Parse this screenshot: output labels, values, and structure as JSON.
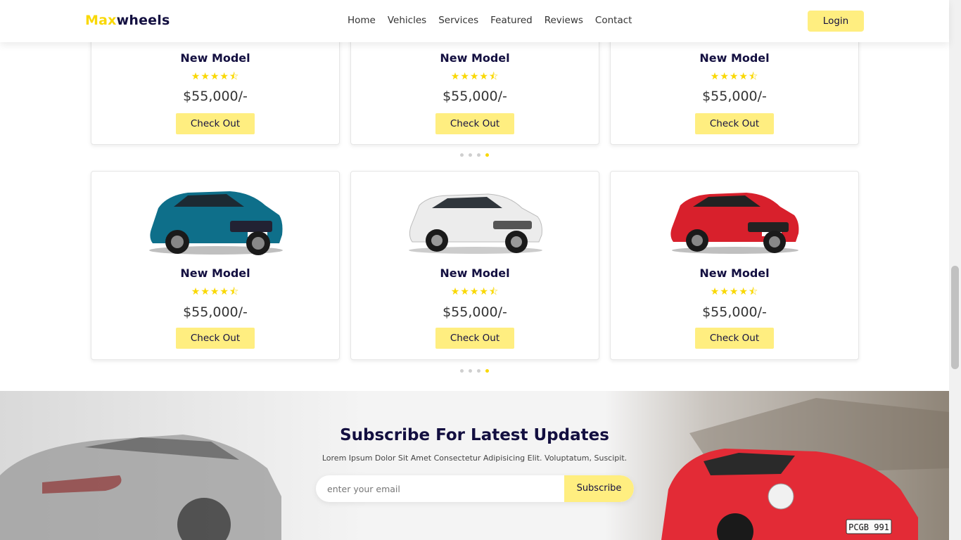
{
  "header": {
    "logo_accent": "Max",
    "logo_rest": "wheels",
    "nav": [
      "Home",
      "Vehicles",
      "Services",
      "Featured",
      "Reviews",
      "Contact"
    ],
    "login_label": "Login"
  },
  "colors": {
    "accent": "#f9d806",
    "button": "#ffee80",
    "text": "#130f40"
  },
  "cards_row1": [
    {
      "title": "New Model",
      "rating": 4.5,
      "stars": "★★★★⯪",
      "price": "$55,000/-",
      "button": "Check Out"
    },
    {
      "title": "New Model",
      "rating": 4.5,
      "stars": "★★★★⯪",
      "price": "$55,000/-",
      "button": "Check Out"
    },
    {
      "title": "New Model",
      "rating": 4.5,
      "stars": "★★★★⯪",
      "price": "$55,000/-",
      "button": "Check Out"
    }
  ],
  "cards_row2": [
    {
      "title": "New Model",
      "rating": 4.5,
      "stars": "★★★★⯪",
      "price": "$55,000/-",
      "button": "Check Out",
      "car_color": "#0e6f8a"
    },
    {
      "title": "New Model",
      "rating": 4.5,
      "stars": "★★★★⯪",
      "price": "$55,000/-",
      "button": "Check Out",
      "car_color": "#e8e8e8"
    },
    {
      "title": "New Model",
      "rating": 4.5,
      "stars": "★★★★⯪",
      "price": "$55,000/-",
      "button": "Check Out",
      "car_color": "#d8202c"
    }
  ],
  "slider": {
    "dot_count": 4,
    "active_index": 3
  },
  "newsletter": {
    "title": "Subscribe For Latest Updates",
    "text": "Lorem Ipsum Dolor Sit Amet Consectetur Adipisicing Elit. Voluptatum, Suscipit.",
    "placeholder": "enter your email",
    "button": "Subscribe",
    "plate": "PCGB 991"
  }
}
